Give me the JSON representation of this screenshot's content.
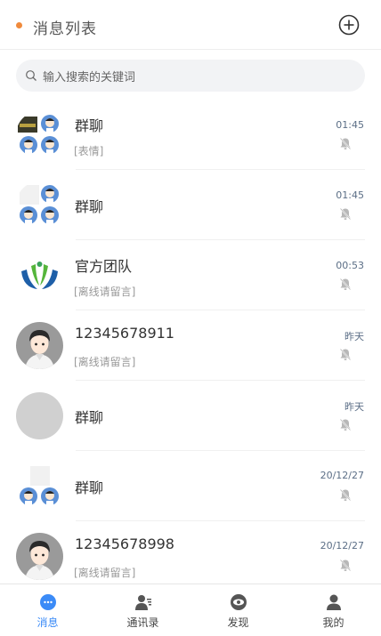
{
  "header": {
    "title": "消息列表"
  },
  "search": {
    "placeholder": "输入搜索的关键词"
  },
  "conversations": [
    {
      "name": "群聊",
      "preview": "[表情]",
      "time": "01:45",
      "muted": true,
      "avatar": "group-avatar-4"
    },
    {
      "name": "群聊",
      "preview": "",
      "time": "01:45",
      "muted": true,
      "avatar": "group-avatar-3"
    },
    {
      "name": "官方团队",
      "preview": "[离线请留言]",
      "time": "00:53",
      "muted": true,
      "avatar": "official-logo"
    },
    {
      "name": "12345678911",
      "preview": "[离线请留言]",
      "time": "昨天",
      "muted": true,
      "avatar": "user-avatar-male"
    },
    {
      "name": "群聊",
      "preview": "",
      "time": "昨天",
      "muted": true,
      "avatar": "empty-avatar"
    },
    {
      "name": "群聊",
      "preview": "",
      "time": "20/12/27",
      "muted": true,
      "avatar": "group-avatar-2"
    },
    {
      "name": "12345678998",
      "preview": "[离线请留言]",
      "time": "20/12/27",
      "muted": true,
      "avatar": "user-avatar-male"
    }
  ],
  "tabs": [
    {
      "label": "消息",
      "icon": "chat-bubble-icon",
      "active": true
    },
    {
      "label": "通讯录",
      "icon": "contacts-icon",
      "active": false
    },
    {
      "label": "发现",
      "icon": "discover-eye-icon",
      "active": false
    },
    {
      "label": "我的",
      "icon": "profile-icon",
      "active": false
    }
  ],
  "colors": {
    "accent": "#3b8bf7",
    "dot": "#f08a3c",
    "time": "#5b6e86"
  }
}
